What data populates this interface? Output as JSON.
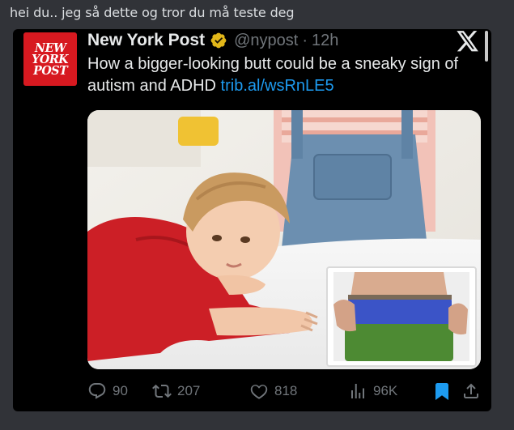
{
  "chat": {
    "message": "hei du.. jeg så dette og tror du må teste deg"
  },
  "tweet": {
    "avatar_lines": [
      "NEW",
      "YORK",
      "POST"
    ],
    "display_name": "New York Post",
    "handle": "@nypost",
    "separator": "·",
    "time": "12h",
    "text": "How a bigger-looking butt could be a sneaky sign of autism and ADHD",
    "link": "trib.al/wsRnLE5",
    "media_alt": "Young boy in red shirt leaning on a table; inset of a person's lower back and waistband"
  },
  "actions": {
    "replies": "90",
    "reposts": "207",
    "likes": "818",
    "views": "96K"
  },
  "colors": {
    "background": "#313338",
    "embed_bg": "#000000",
    "text": "#e7e9ea",
    "muted": "#71767b",
    "link": "#1d9bf0",
    "brand_red": "#d71920",
    "verified_gold": "#e2b719",
    "bookmark_blue": "#1d9bf0"
  },
  "icons": {
    "verified": "verified-badge-icon",
    "x": "x-logo-icon",
    "reply": "reply-icon",
    "repost": "repost-icon",
    "like": "heart-icon",
    "views": "views-icon",
    "bookmark": "bookmark-icon",
    "share": "share-icon"
  }
}
